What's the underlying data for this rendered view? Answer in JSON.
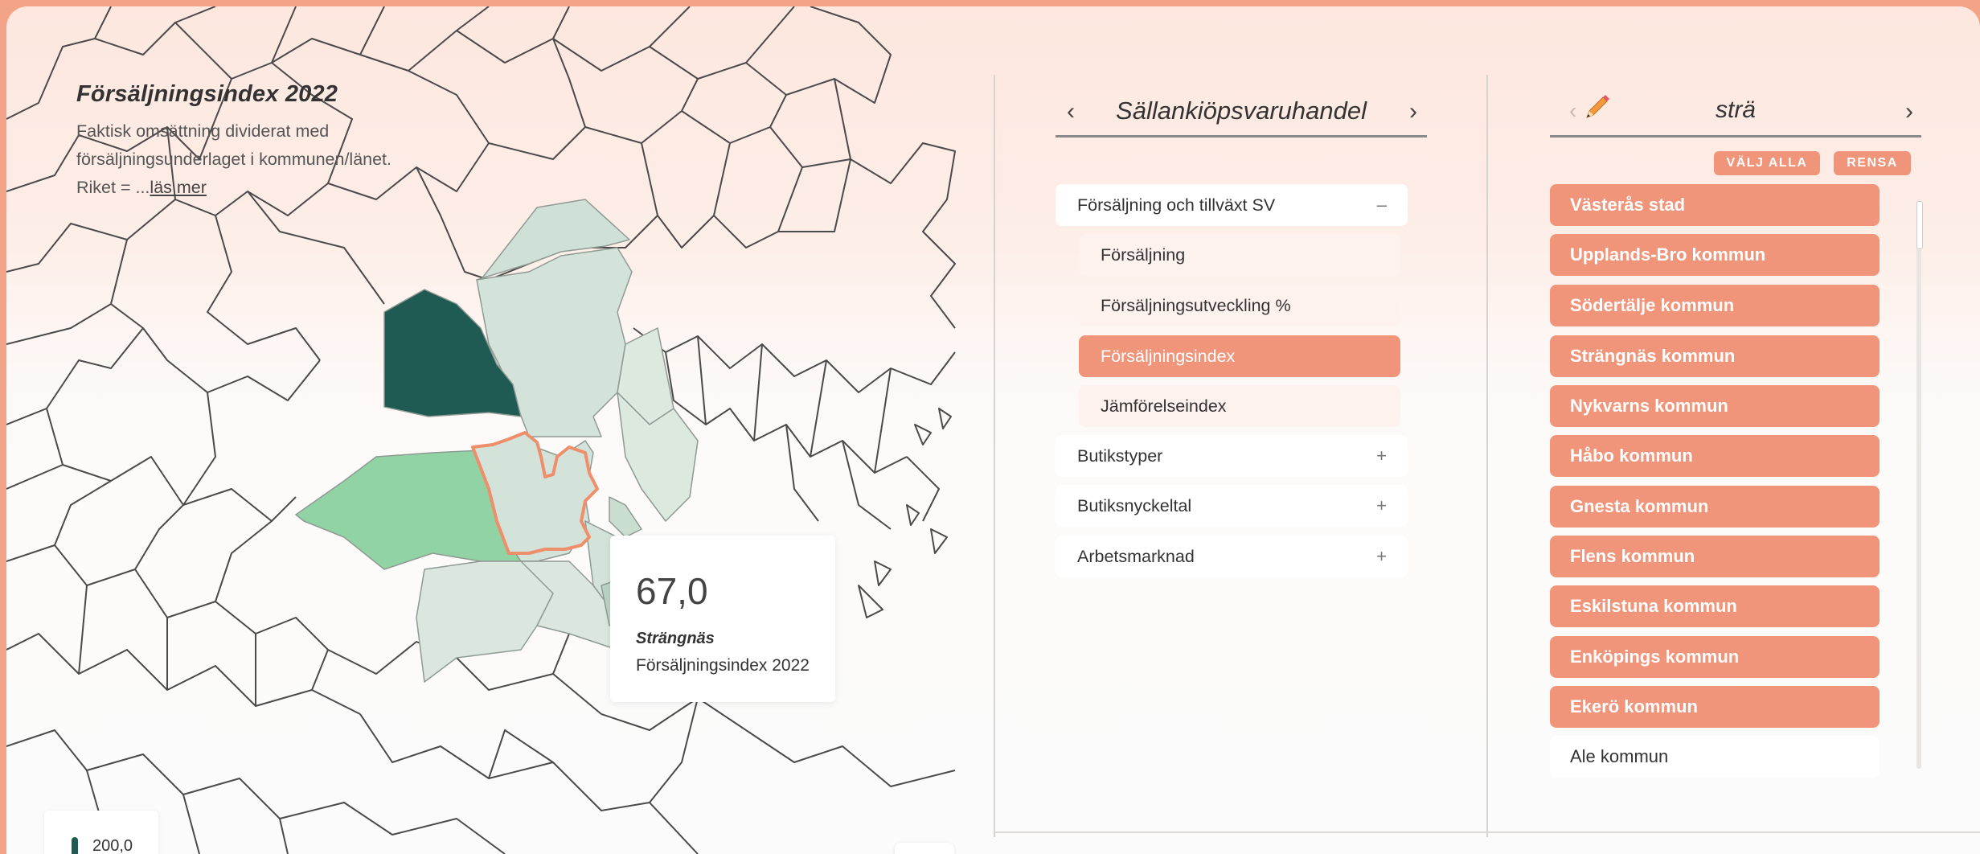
{
  "map": {
    "title": "Försäljningsindex 2022",
    "description": "Faktisk omsättning dividerat med försäljningsunderlaget i kommunen/länet. Riket = ...",
    "read_more": "läs mer",
    "tooltip": {
      "value": "67,0",
      "name": "Strängnäs",
      "metric": "Försäljningsindex 2022"
    },
    "legend_max": "200,0",
    "colors": {
      "dark": "#1f5a53",
      "green": "#91d3a4",
      "light": "#cfe0d6",
      "highlight_border": "#ee8e6a"
    }
  },
  "categories": {
    "title": "Sällankiöpsvaruhandel",
    "prev_icon": "chevron-left-icon",
    "next_icon": "chevron-right-icon",
    "items": [
      {
        "label": "Försäljning och tillväxt SV",
        "toggle": "–"
      },
      {
        "label": "Försäljning"
      },
      {
        "label": "Försäljningsutveckling %"
      },
      {
        "label": "Försäljningsindex"
      },
      {
        "label": "Jämförelseindex"
      },
      {
        "label": "Butikstyper",
        "toggle": "+"
      },
      {
        "label": "Butiksnyckeltal",
        "toggle": "+"
      },
      {
        "label": "Arbetsmarknad",
        "toggle": "+"
      }
    ]
  },
  "municipalities": {
    "query": "strä",
    "select_all": "VÄLJ ALLA",
    "clear": "RENSA",
    "items": [
      "Västerås stad",
      "Upplands-Bro kommun",
      "Södertälje kommun",
      "Strängnäs kommun",
      "Nykvarns kommun",
      "Håbo kommun",
      "Gnesta kommun",
      "Flens kommun",
      "Eskilstuna kommun",
      "Enköpings kommun",
      "Ekerö kommun",
      "Ale kommun"
    ],
    "accent": "#f0957a"
  }
}
